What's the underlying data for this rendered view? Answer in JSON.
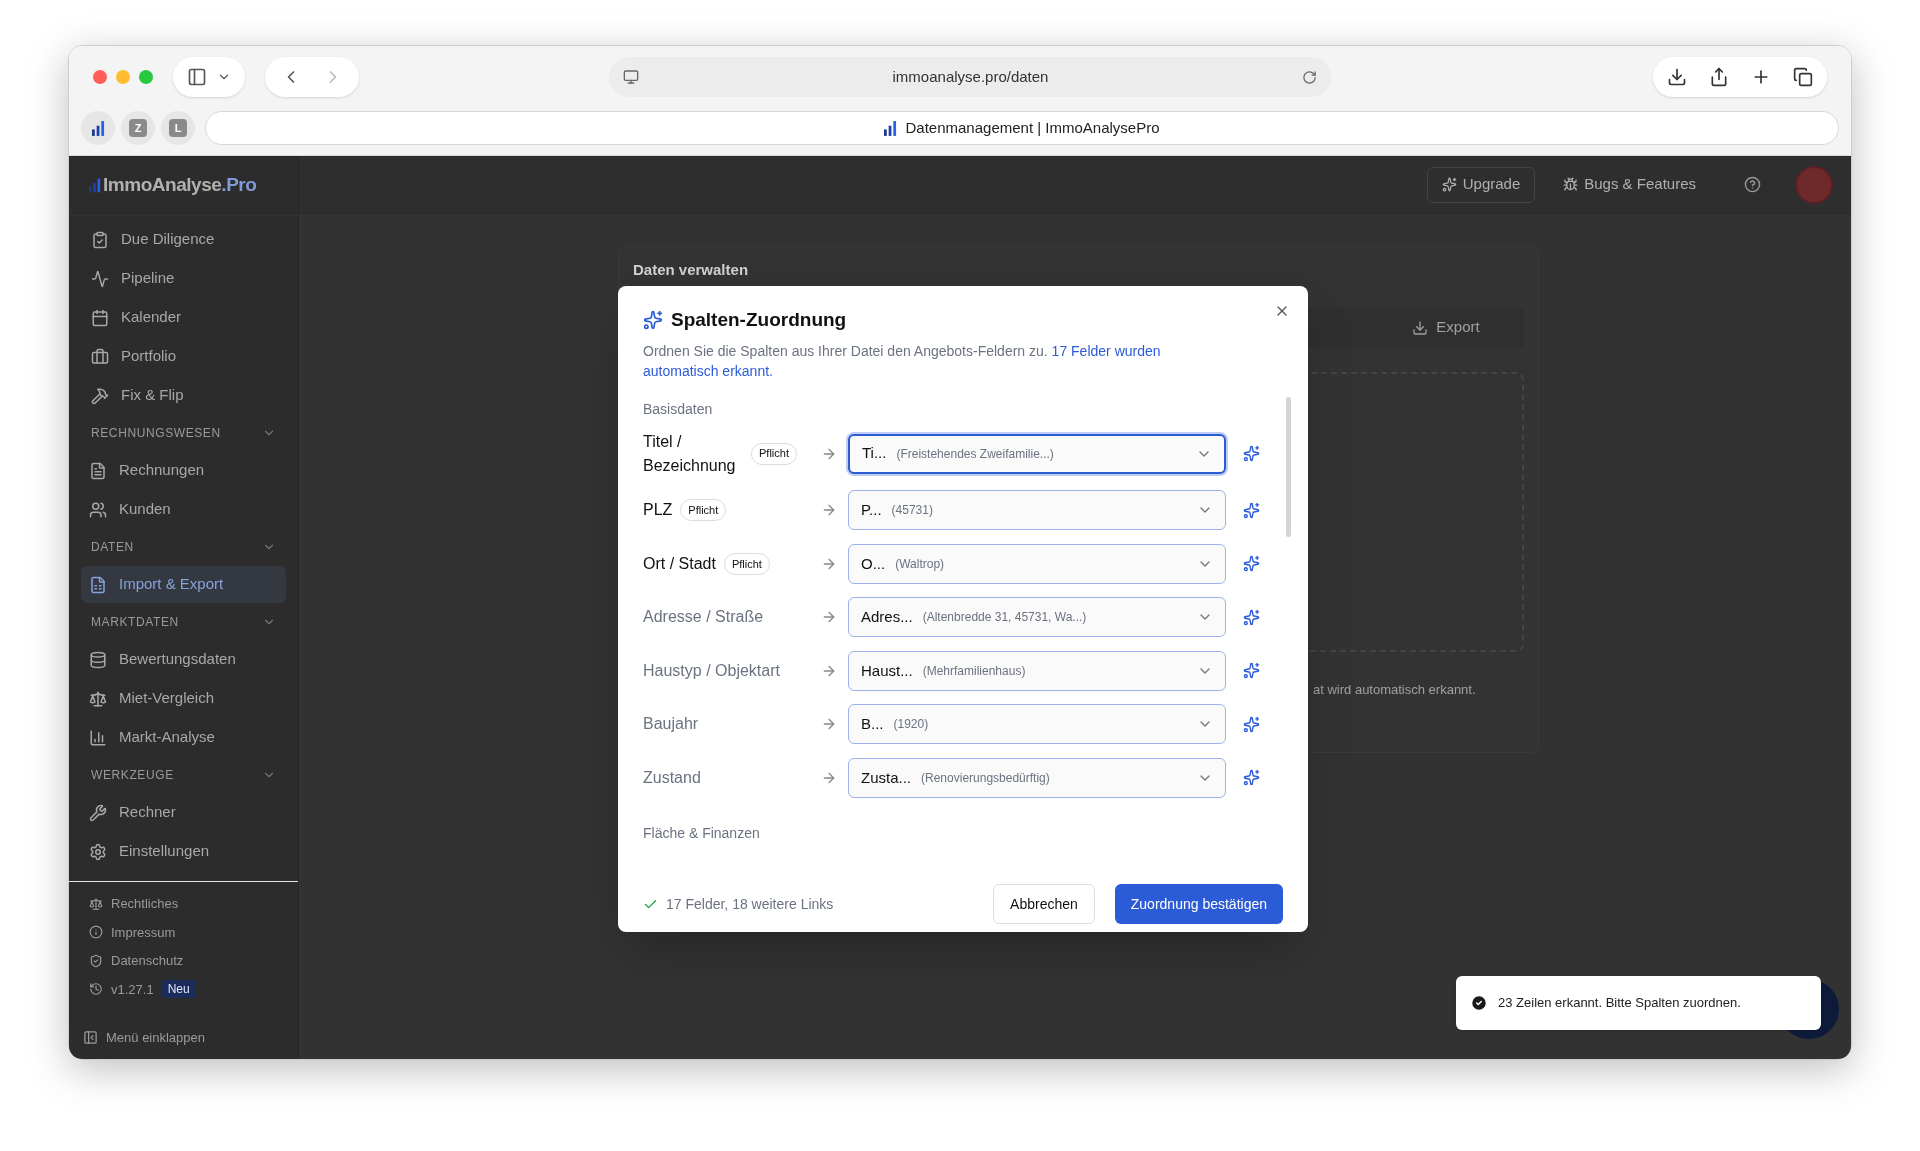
{
  "browser": {
    "url": "immoanalyse.pro/daten",
    "tab_title": "Datenmanagement | ImmoAnalysePro",
    "pinned_tabs": [
      {
        "kind": "logo"
      },
      {
        "kind": "letter",
        "label": "Z"
      },
      {
        "kind": "letter",
        "label": "L"
      }
    ]
  },
  "app": {
    "logo": "ImmoAnalyse",
    "logo_accent": ".Pro",
    "header_actions": [
      "Upgrade",
      "Bugs & Features"
    ]
  },
  "sidebar": {
    "groups": [
      {
        "items": [
          {
            "label": "Due Diligence",
            "selected": false
          },
          {
            "label": "Pipeline",
            "selected": false
          },
          {
            "label": "Kalender",
            "selected": false
          },
          {
            "label": "Portfolio",
            "selected": false
          },
          {
            "label": "Fix & Flip",
            "selected": false
          }
        ]
      },
      {
        "heading": "RECHNUNGSWESEN",
        "expanded": true,
        "items": [
          {
            "label": "Rechnungen",
            "selected": false
          },
          {
            "label": "Kunden",
            "selected": false
          }
        ]
      },
      {
        "heading": "DATEN",
        "expanded": true,
        "items": [
          {
            "label": "Import & Export",
            "selected": true
          }
        ]
      },
      {
        "heading": "MARKTDATEN",
        "expanded": true,
        "items": [
          {
            "label": "Bewertungsdaten",
            "selected": false
          },
          {
            "label": "Miet-Vergleich",
            "selected": false
          },
          {
            "label": "Markt-Analyse",
            "selected": false
          }
        ]
      },
      {
        "heading": "WERKZEUGE",
        "expanded": true,
        "items": [
          {
            "label": "Rechner",
            "selected": false
          },
          {
            "label": "Einstellungen",
            "selected": false
          }
        ]
      }
    ],
    "footer_links": [
      "Rechtliches",
      "Impressum",
      "Datenschutz"
    ],
    "version": "v1.27.1",
    "version_badge": "Neu",
    "collapse": "Menü einklappen"
  },
  "page": {
    "title": "Daten verwalten",
    "export_button": "Export",
    "hint": "at wird automatisch erkannt."
  },
  "dialog": {
    "title": "Spalten-Zuordnung",
    "description": "Ordnen Sie die Spalten aus Ihrer Datei den Angebots-Feldern zu.",
    "description_highlight": "17 Felder wurden automatisch erkannt.",
    "sections": [
      {
        "title": "Basisdaten",
        "fields": [
          {
            "label": "Titel / Bezeichnung",
            "required": true,
            "badge": "Pflicht",
            "column": "Ti...",
            "sample": "(Freistehendes Zweifamilie...)",
            "focused": true
          },
          {
            "label": "PLZ",
            "required": true,
            "badge": "Pflicht",
            "column": "P...",
            "sample": "(45731)",
            "focused": false
          },
          {
            "label": "Ort / Stadt",
            "required": true,
            "badge": "Pflicht",
            "column": "O...",
            "sample": "(Waltrop)",
            "focused": false
          },
          {
            "label": "Adresse / Straße",
            "required": false,
            "column": "Adres...",
            "sample": "(Altenbredde 31, 45731, Wa...)",
            "focused": false
          },
          {
            "label": "Haustyp / Objektart",
            "required": false,
            "column": "Haust...",
            "sample": "(Mehrfamilienhaus)",
            "focused": false
          },
          {
            "label": "Baujahr",
            "required": false,
            "column": "B...",
            "sample": "(1920)",
            "focused": false
          },
          {
            "label": "Zustand",
            "required": false,
            "column": "Zusta...",
            "sample": "(Renovierungsbedürftig)",
            "focused": false
          }
        ]
      },
      {
        "title": "Fläche & Finanzen"
      }
    ],
    "summary": "17 Felder, 18 weitere Links",
    "cancel": "Abbrechen",
    "confirm": "Zuordnung bestätigen"
  },
  "toast": {
    "message": "23 Zeilen erkannt. Bitte Spalten zuordnen."
  }
}
